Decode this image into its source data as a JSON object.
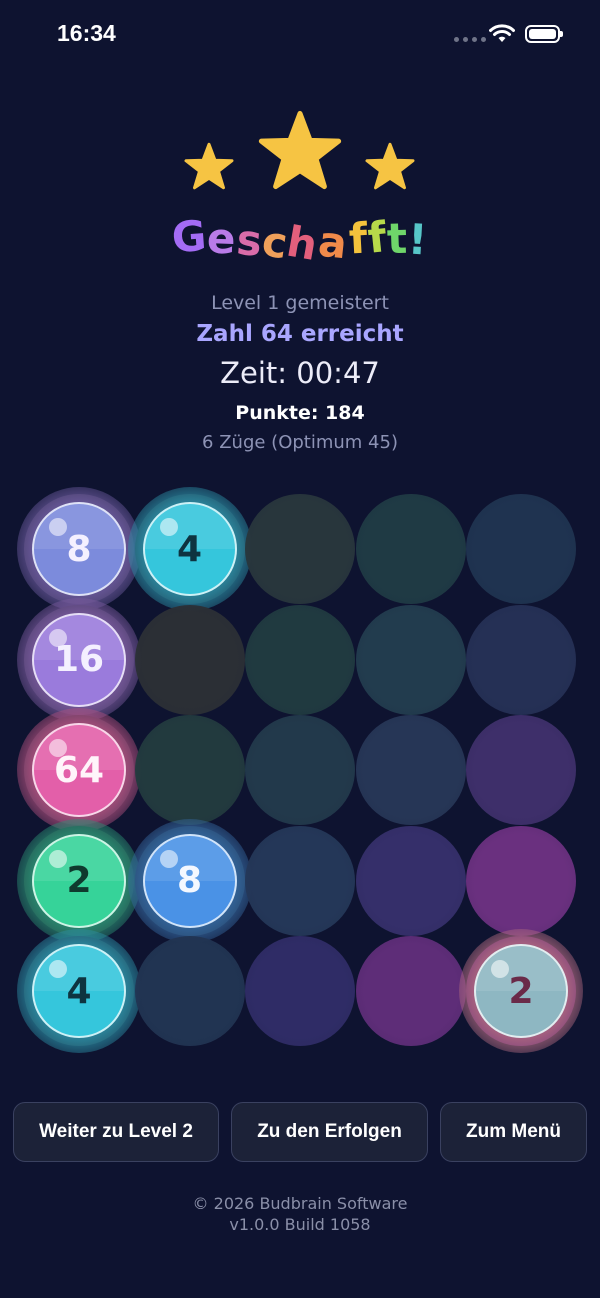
{
  "status_bar": {
    "time": "16:34"
  },
  "result": {
    "title": "Geschafft!",
    "title_colors": [
      "#a46cf5",
      "#b97be8",
      "#d96ca9",
      "#f0a05a",
      "#e35f7c",
      "#f08a4a",
      "#f4c23c",
      "#b7d94a",
      "#6fd66a",
      "#57c6c8"
    ],
    "level_text": "Level 1 gemeistert",
    "reached_text": "Zahl 64 erreicht",
    "time_text": "Zeit: 00:47",
    "points_text": "Punkte: 184",
    "moves_text": "6 Züge (Optimum 45)",
    "stars_earned": 3
  },
  "board": {
    "rows": [
      [
        8,
        4,
        null,
        null,
        null
      ],
      [
        16,
        null,
        null,
        null,
        null
      ],
      [
        64,
        null,
        null,
        null,
        null
      ],
      [
        2,
        8,
        null,
        null,
        null
      ],
      [
        4,
        null,
        null,
        null,
        2
      ]
    ],
    "empty_colors": [
      [
        "#3b3555",
        "#243346",
        "#28363c",
        "#1f3a44",
        "#1f3350"
      ],
      [
        "#3a3557",
        "#2b2f35",
        "#203a40",
        "#223c4e",
        "#253055"
      ],
      [
        "#3a3452",
        "#223a3e",
        "#22394b",
        "#263656",
        "#3e2f6a"
      ],
      [
        "#253c43",
        "#223a56",
        "#243758",
        "#352f6a",
        "#6a307f"
      ],
      [
        "#24384a",
        "#213452",
        "#2f2c66",
        "#5e2d78",
        "#6a2f7c"
      ]
    ]
  },
  "tile_styles": {
    "2": {
      "ball": "#36d399",
      "glow": "#2a8f73",
      "text": "#0f3a2e"
    },
    "4": {
      "ball": "#35c6dc",
      "glow": "#2b8fa6",
      "text": "#0e3440"
    },
    "8": {
      "ball": "#7c8bdc",
      "glow": "#6b5a9e",
      "text": "#f4f0ff"
    },
    "16": {
      "ball": "#9a7bdc",
      "glow": "#7a5a9e",
      "text": "#f4f0ff"
    },
    "64": {
      "ball": "#e35fa9",
      "glow": "#b0507e",
      "text": "#fff4fa"
    },
    "8b": {
      "ball": "#4a92e6",
      "glow": "#3568a0",
      "text": "#f4f8ff"
    },
    "2b": {
      "ball": "#8eb7c2",
      "glow": "#b06a80",
      "text": "#6a2a48"
    }
  },
  "buttons": {
    "next_level": "Weiter zu Level 2",
    "achievements": "Zu den Erfolgen",
    "menu": "Zum Menü"
  },
  "footer": {
    "copyright": "© 2026 Budbrain Software",
    "version": "v1.0.0 Build 1058"
  },
  "colors": {
    "background": "#0e1330",
    "star": "#f6c443",
    "button_bg": "#1c2238",
    "button_border": "#3a4160"
  }
}
